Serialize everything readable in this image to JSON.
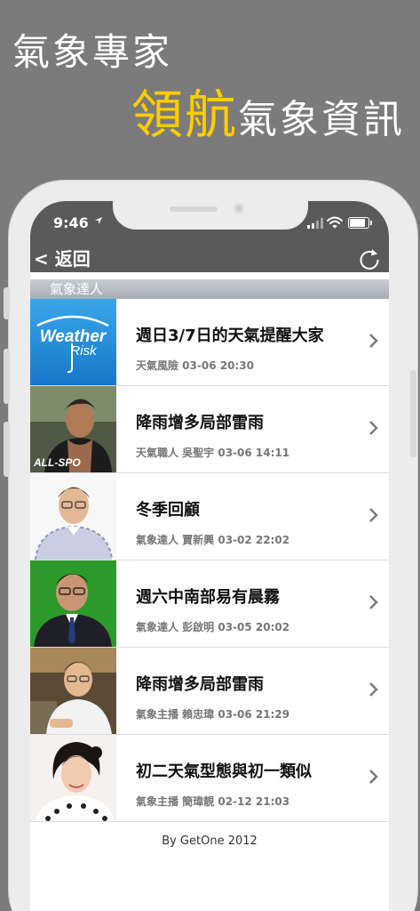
{
  "promo": {
    "line1": "氣象專家",
    "accent": "領航",
    "rest": "氣象資訊",
    "accent_color": "#ffcc00"
  },
  "status_bar": {
    "time": "9:46",
    "location_icon": "location-arrow-icon",
    "signal_icon": "cellular-signal-icon",
    "wifi_icon": "wifi-icon",
    "battery_icon": "battery-icon"
  },
  "navbar": {
    "back_label": "< 返回",
    "refresh_icon": "refresh-icon"
  },
  "section": {
    "title": "氣象達人"
  },
  "items": [
    {
      "title": "週日3/7日的天氣提醒大家",
      "meta": "天氣風險 03-06 20:30",
      "thumb": "weather-risk-logo"
    },
    {
      "title": "降雨增多局部雷雨",
      "meta": "天氣職人 吳聖宇 03-06 14:11",
      "thumb": "runner-portrait"
    },
    {
      "title": "冬季回顧",
      "meta": "氣象達人 賈新興 03-02 22:02",
      "thumb": "glasses-man-portrait"
    },
    {
      "title": "週六中南部易有晨霧",
      "meta": "氣象達人 彭啟明 03-05 20:02",
      "thumb": "suit-man-portrait"
    },
    {
      "title": "降雨增多局部雷雨",
      "meta": "氣象主播 賴忠瑋 03-06 21:29",
      "thumb": "young-man-portrait"
    },
    {
      "title": "初二天氣型態與初一類似",
      "meta": "氣象主播 簡瑋靚 02-12 21:03",
      "thumb": "woman-portrait"
    }
  ],
  "footer": {
    "text": "By GetOne 2012"
  },
  "logo": {
    "line1": "Weather",
    "line2": "Risk"
  }
}
